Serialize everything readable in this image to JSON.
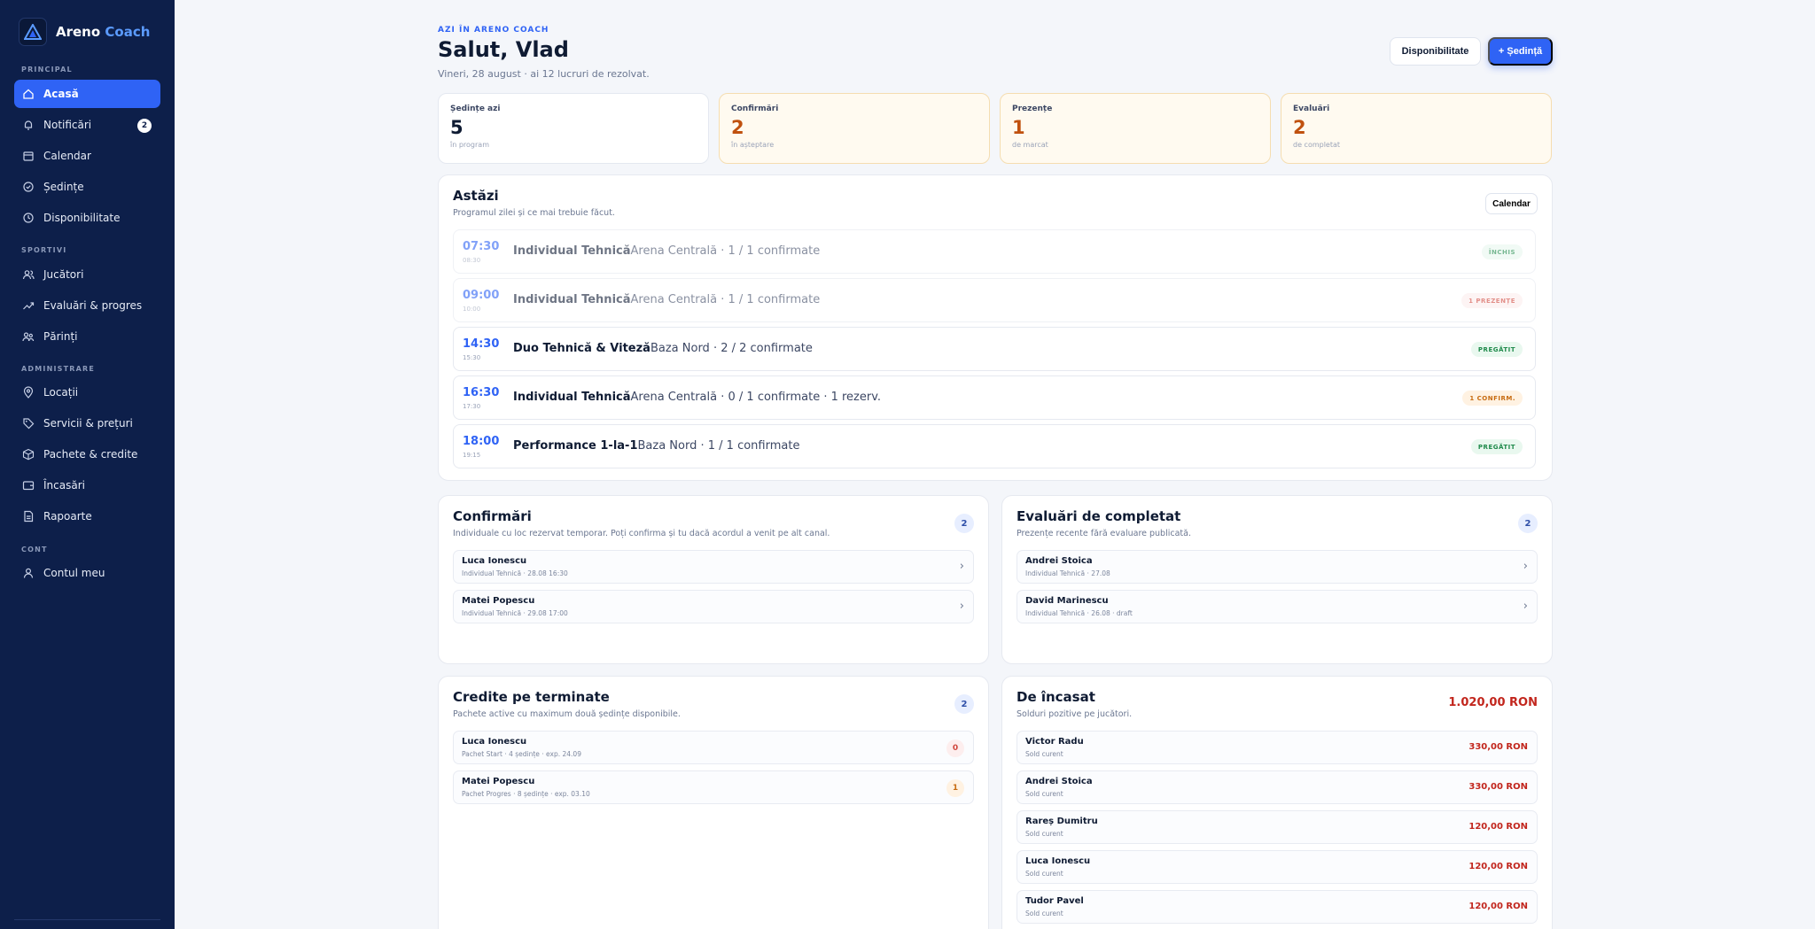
{
  "brand": {
    "name_main": "Areno",
    "name_accent": "Coach"
  },
  "sidebar": {
    "sections": [
      {
        "label": "PRINCIPAL"
      },
      {
        "label": "SPORTIVI"
      },
      {
        "label": "ADMINISTRARE"
      },
      {
        "label": "CONT"
      }
    ],
    "items": [
      {
        "label": "Acasă",
        "icon": "home-icon"
      },
      {
        "label": "Notificări",
        "icon": "bell-icon",
        "badge": "2"
      },
      {
        "label": "Calendar",
        "icon": "calendar-icon"
      },
      {
        "label": "Ședințe",
        "icon": "check-circle-icon"
      },
      {
        "label": "Disponibilitate",
        "icon": "clock-icon"
      },
      {
        "label": "Jucători",
        "icon": "users-icon"
      },
      {
        "label": "Evaluări & progres",
        "icon": "trend-icon"
      },
      {
        "label": "Părinți",
        "icon": "parents-icon"
      },
      {
        "label": "Locații",
        "icon": "pin-icon"
      },
      {
        "label": "Servicii & prețuri",
        "icon": "tag-icon"
      },
      {
        "label": "Pachete & credite",
        "icon": "box-icon"
      },
      {
        "label": "Încasări",
        "icon": "wallet-icon"
      },
      {
        "label": "Rapoarte",
        "icon": "report-icon"
      },
      {
        "label": "Contul meu",
        "icon": "user-icon"
      }
    ]
  },
  "header": {
    "eyebrow": "AZI ÎN ARENO COACH",
    "greeting": "Salut, Vlad",
    "subline": "Vineri, 28 august · ai 12 lucruri de rezolvat.",
    "btn_availability": "Disponibilitate",
    "btn_new_session": "+ Ședință"
  },
  "stats": [
    {
      "label": "Ședințe azi",
      "value": "5",
      "sub": "în program"
    },
    {
      "label": "Confirmări",
      "value": "2",
      "sub": "în așteptare"
    },
    {
      "label": "Prezențe",
      "value": "1",
      "sub": "de marcat"
    },
    {
      "label": "Evaluări",
      "value": "2",
      "sub": "de completat"
    }
  ],
  "today": {
    "title": "Astăzi",
    "subtitle": "Programul zilei și ce mai trebuie făcut.",
    "calendar_btn": "Calendar",
    "sessions": [
      {
        "start": "07:30",
        "end": "08:30",
        "name": "Individual Tehnică",
        "details": "Arena Centrală · 1 / 1 confirmate",
        "status": "ÎNCHIS"
      },
      {
        "start": "09:00",
        "end": "10:00",
        "name": "Individual Tehnică",
        "details": "Arena Centrală · 1 / 1 confirmate",
        "status": "1 PREZENȚE"
      },
      {
        "start": "14:30",
        "end": "15:30",
        "name": "Duo Tehnică & Viteză",
        "details": "Baza Nord · 2 / 2 confirmate",
        "status": "PREGĂTIT"
      },
      {
        "start": "16:30",
        "end": "17:30",
        "name": "Individual Tehnică",
        "details": "Arena Centrală · 0 / 1 confirmate · 1 rezerv.",
        "status": "1 CONFIRM."
      },
      {
        "start": "18:00",
        "end": "19:15",
        "name": "Performance 1-la-1",
        "details": "Baza Nord · 1 / 1 confirmate",
        "status": "PREGĂTIT"
      }
    ]
  },
  "confirmations": {
    "title": "Confirmări",
    "subtitle": "Individuale cu loc rezervat temporar. Poți confirma și tu dacă acordul a venit pe alt canal.",
    "count": "2",
    "items": [
      {
        "name": "Luca Ionescu",
        "meta": "Individual Tehnică · 28.08 16:30"
      },
      {
        "name": "Matei Popescu",
        "meta": "Individual Tehnică · 29.08 17:00"
      }
    ]
  },
  "evaluations": {
    "title": "Evaluări de completat",
    "subtitle": "Prezențe recente fără evaluare publicată.",
    "count": "2",
    "items": [
      {
        "name": "Andrei Stoica",
        "meta": "Individual Tehnică · 27.08"
      },
      {
        "name": "David Marinescu",
        "meta": "Individual Tehnică · 26.08 · draft"
      }
    ]
  },
  "credits": {
    "title": "Credite pe terminate",
    "subtitle": "Pachete active cu maximum două ședințe disponibile.",
    "count": "2",
    "items": [
      {
        "name": "Luca Ionescu",
        "meta": "Pachet Start · 4 ședințe · exp. 24.09",
        "left": "0"
      },
      {
        "name": "Matei Popescu",
        "meta": "Pachet Progres · 8 ședințe · exp. 03.10",
        "left": "1"
      }
    ]
  },
  "collect": {
    "title": "De încasat",
    "subtitle": "Solduri pozitive pe jucători.",
    "total": "1.020,00 RON",
    "items": [
      {
        "name": "Victor Radu",
        "meta": "Sold curent",
        "amount": "330,00 RON"
      },
      {
        "name": "Andrei Stoica",
        "meta": "Sold curent",
        "amount": "330,00 RON"
      },
      {
        "name": "Rareș Dumitru",
        "meta": "Sold curent",
        "amount": "120,00 RON"
      },
      {
        "name": "Luca Ionescu",
        "meta": "Sold curent",
        "amount": "120,00 RON"
      },
      {
        "name": "Tudor Pavel",
        "meta": "Sold curent",
        "amount": "120,00 RON"
      }
    ]
  },
  "colors": {
    "accent": "#2f63f5",
    "sidebar": "#0d1f4a",
    "warning": "#c0510f",
    "danger": "#c2261d"
  }
}
